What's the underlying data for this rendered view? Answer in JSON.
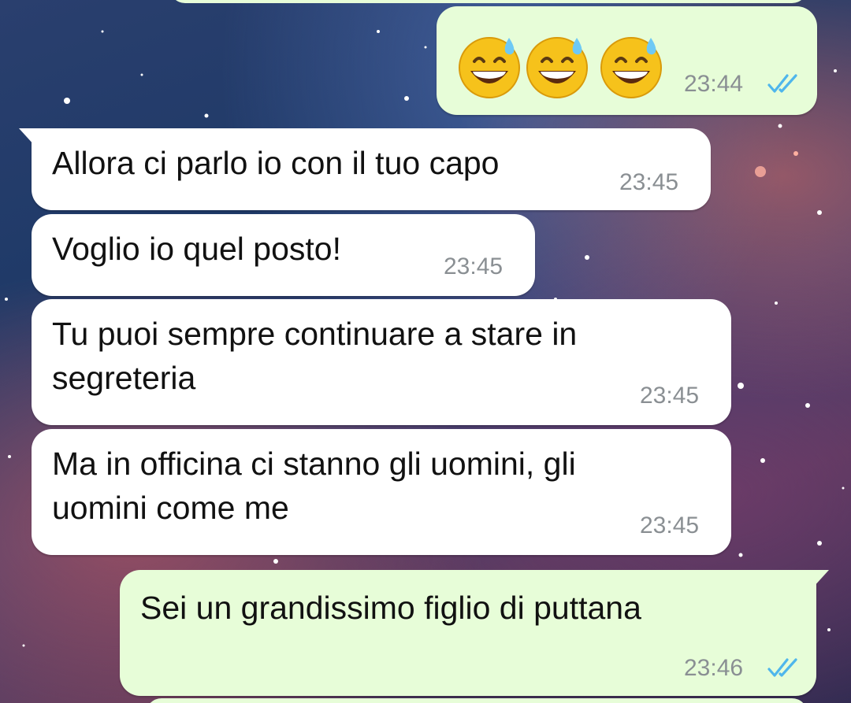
{
  "chat": {
    "messages": [
      {
        "direction": "outgoing",
        "emojis": [
          "grinning-sweat-emoji",
          "grinning-sweat-emoji",
          "grinning-sweat-emoji"
        ],
        "time": "23:44",
        "status": "read"
      },
      {
        "direction": "incoming",
        "text": "Allora ci parlo io con il tuo capo",
        "time": "23:45"
      },
      {
        "direction": "incoming",
        "text": "Voglio io quel posto!",
        "time": "23:45"
      },
      {
        "direction": "incoming",
        "text": "Tu puoi sempre continuare a stare in\nsegreteria",
        "time": "23:45"
      },
      {
        "direction": "incoming",
        "text": "Ma in officina ci stanno gli uomini, gli\nuomini come me",
        "time": "23:45"
      },
      {
        "direction": "outgoing",
        "text": "Sei un grandissimo figlio di puttana",
        "time": "23:46",
        "status": "read"
      }
    ]
  },
  "colors": {
    "incoming_bubble": "#ffffff",
    "outgoing_bubble": "#e7fdd8",
    "read_tick": "#4fb6ec",
    "timestamp": "#8a8f93"
  }
}
